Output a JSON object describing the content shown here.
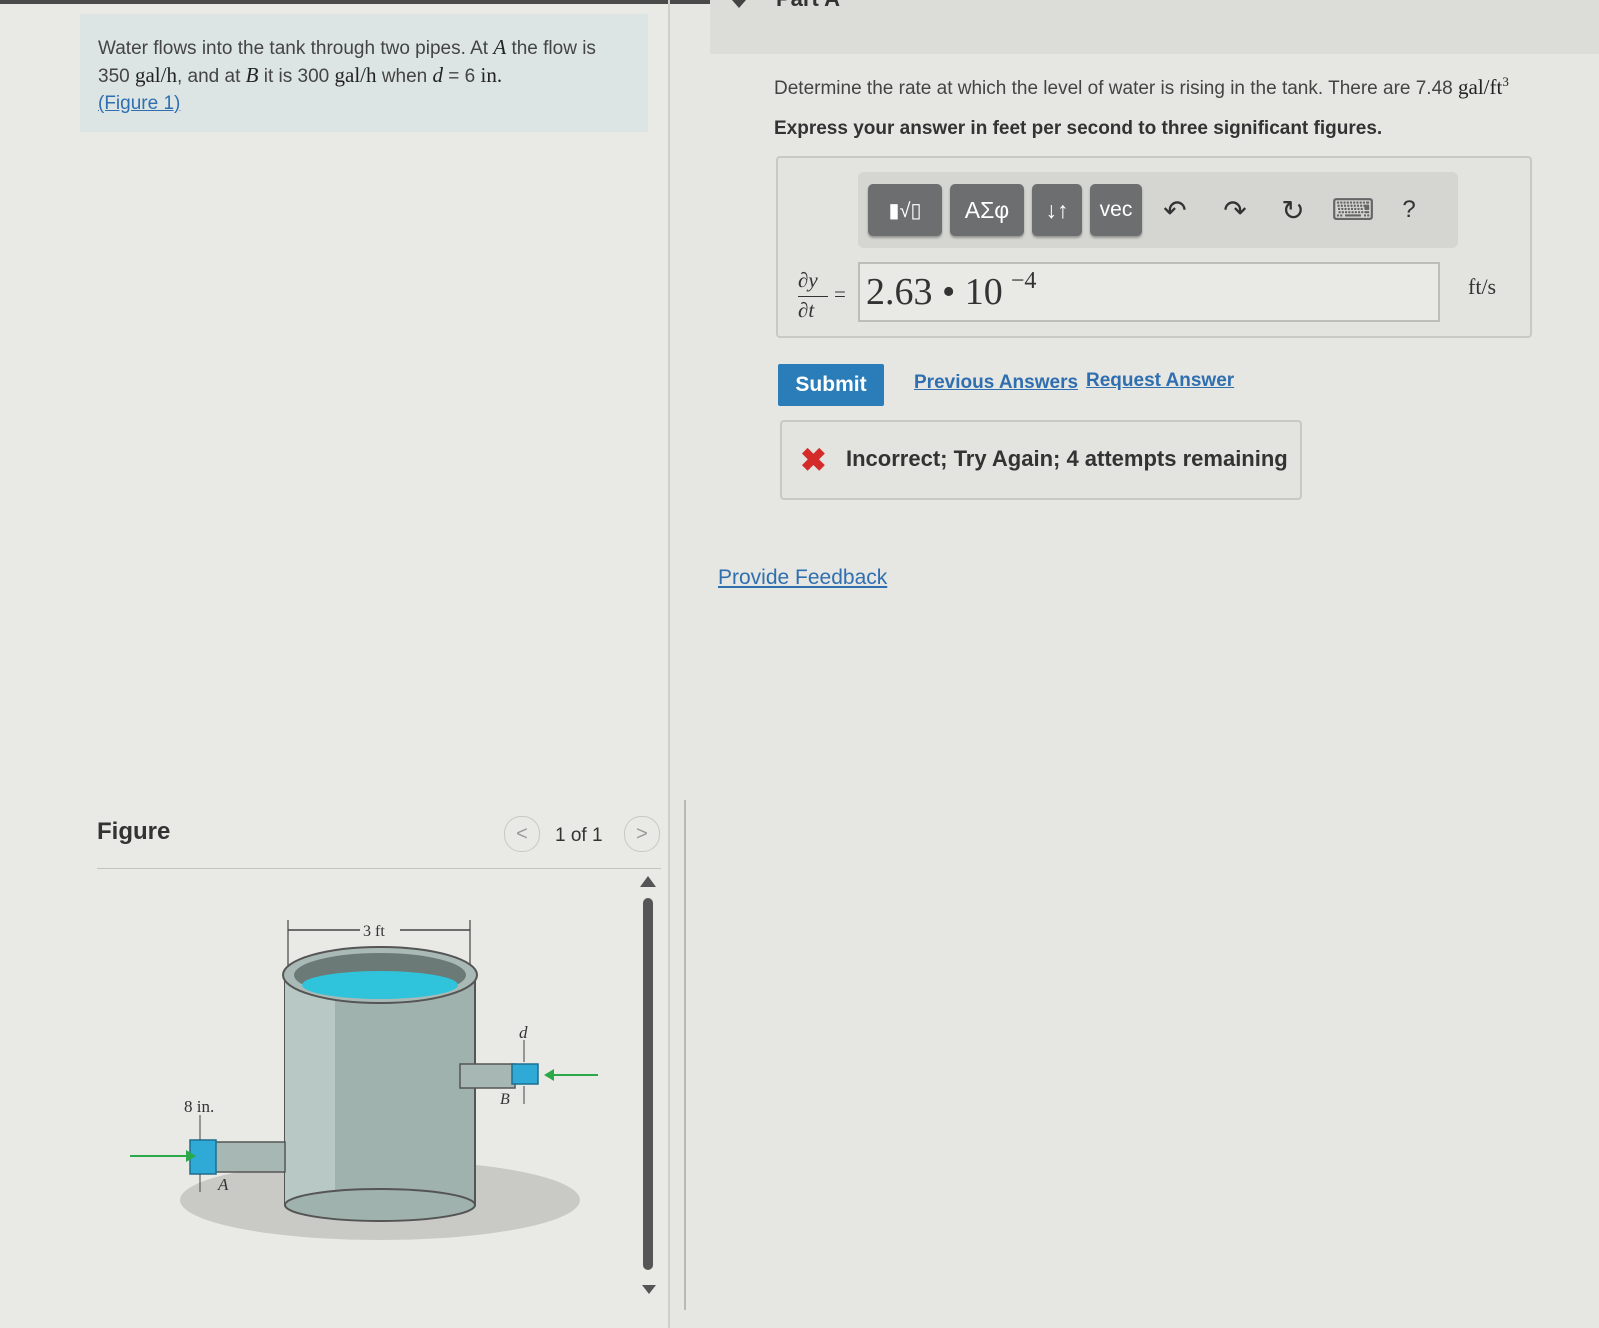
{
  "problem": {
    "text1": "Water flows into the tank through two pipes. At",
    "point_a": "A",
    "text2": "the flow is",
    "flow_a_num": "350",
    "flow_a_unit": "gal/h",
    "text3": ", and at",
    "point_b": "B",
    "text4": "it is",
    "flow_b_num": "300",
    "flow_b_unit": "gal/h",
    "text5": "when",
    "var_d": "d",
    "eq_d": "= 6",
    "d_unit": "in.",
    "figure_link": "(Figure 1)"
  },
  "part": {
    "title": "Part A"
  },
  "question": {
    "text": "Determine the rate at which the level of water is rising in the tank. There are 7.48",
    "unit": "gal/ft",
    "unit_exp": "3",
    "instruction": "Express your answer in feet per second to three significant figures."
  },
  "toolbar": {
    "templates_label": "▮√▯",
    "greek_label": "ΑΣφ",
    "arrows_label": "↓↑",
    "vec_label": "vec",
    "undo": "↶",
    "redo": "↷",
    "reset": "↻",
    "keyboard": "⌨",
    "help": "?"
  },
  "answer": {
    "lhs_top": "∂y",
    "lhs_bottom": "∂t",
    "equals": "=",
    "value": "2.63 • 10",
    "exponent": "−4",
    "units": "ft/s"
  },
  "actions": {
    "submit": "Submit",
    "previous_answers": "Previous Answers",
    "request_answer": "Request Answer"
  },
  "feedback": {
    "icon": "✖",
    "message": "Incorrect; Try Again; 4 attempts remaining"
  },
  "provide_feedback": "Provide Feedback",
  "figure": {
    "title": "Figure",
    "prev": "<",
    "next": ">",
    "counter": "1 of 1",
    "label_width": "3 ft",
    "label_pipe_a": "8 in.",
    "label_a": "A",
    "label_b": "B",
    "label_d": "d"
  },
  "colors": {
    "accent": "#2a7db8",
    "link": "#2f6fb0",
    "error": "#d42a2a",
    "water": "#2fc4dc"
  }
}
